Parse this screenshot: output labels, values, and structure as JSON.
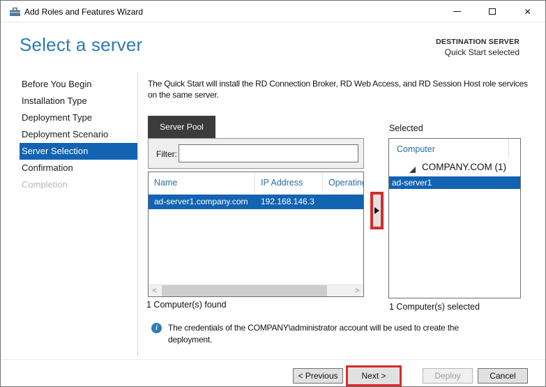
{
  "window": {
    "title": "Add Roles and Features Wizard"
  },
  "header": {
    "title": "Select a server",
    "destination_label": "DESTINATION SERVER",
    "destination_value": "Quick Start selected"
  },
  "sidebar": {
    "items": [
      {
        "label": "Before You Begin",
        "state": "normal"
      },
      {
        "label": "Installation Type",
        "state": "normal"
      },
      {
        "label": "Deployment Type",
        "state": "normal"
      },
      {
        "label": "Deployment Scenario",
        "state": "normal"
      },
      {
        "label": "Server Selection",
        "state": "selected"
      },
      {
        "label": "Confirmation",
        "state": "normal"
      },
      {
        "label": "Completion",
        "state": "disabled"
      }
    ]
  },
  "content": {
    "description": "The Quick Start will install the RD Connection Broker, RD Web Access, and RD Session Host role services on the same server.",
    "server_pool": {
      "tab_label": "Server Pool",
      "filter_label": "Filter:",
      "filter_value": "",
      "columns": {
        "name": "Name",
        "ip": "IP Address",
        "os": "Operating"
      },
      "row": {
        "name": "ad-server1.company.com",
        "ip": "192.168.146.3",
        "selected": true
      },
      "found_text": "1 Computer(s) found"
    },
    "selected_panel": {
      "label": "Selected",
      "column_header": "Computer",
      "group_label": "COMPANY.COM (1)",
      "item_label": "ad-server1",
      "item_selected": true,
      "selected_text": "1 Computer(s) selected"
    },
    "info_text": "The credentials of the COMPANY\\administrator account will be used to create the deployment."
  },
  "footer": {
    "previous_label": "< Previous",
    "next_label": "Next >",
    "deploy_label": "Deploy",
    "deploy_disabled": true,
    "cancel_label": "Cancel"
  },
  "icons": {
    "close_glyph": "✕",
    "scroll_left": "<",
    "scroll_right": ">",
    "info_glyph": "i"
  },
  "colors": {
    "accent_blue": "#2b7bb9",
    "selection_blue": "#1263b2",
    "tab_dark": "#3b3b3b",
    "annotation_red": "#d52c2c",
    "header_text_blue": "#2a6da4"
  }
}
